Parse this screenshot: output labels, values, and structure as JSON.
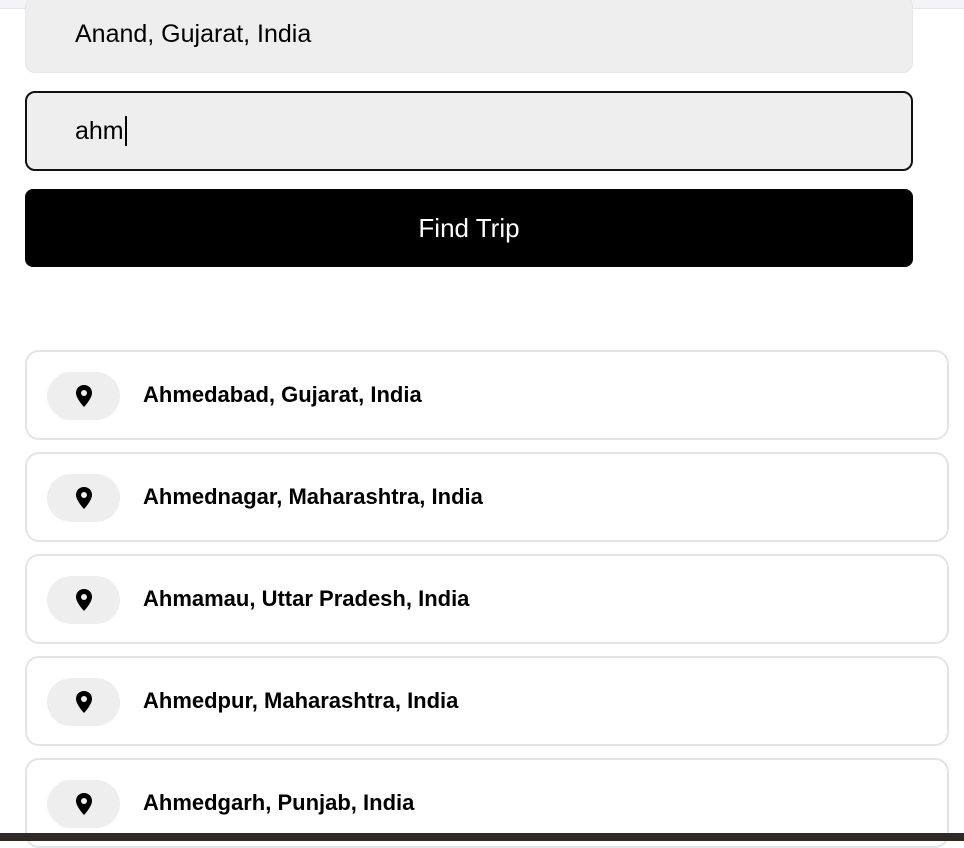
{
  "pickup": {
    "value": "Anand, Gujarat, India"
  },
  "destination": {
    "value": "ahm"
  },
  "find_trip_button": {
    "label": "Find Trip"
  },
  "suggestions": [
    {
      "label": "Ahmedabad, Gujarat, India",
      "icon": "map-pin-icon"
    },
    {
      "label": "Ahmednagar, Maharashtra, India",
      "icon": "map-pin-icon"
    },
    {
      "label": "Ahmamau, Uttar Pradesh, India",
      "icon": "map-pin-icon"
    },
    {
      "label": "Ahmedpur, Maharashtra, India",
      "icon": "map-pin-icon"
    },
    {
      "label": "Ahmedgarh, Punjab, India",
      "icon": "map-pin-icon"
    }
  ],
  "colors": {
    "button_bg": "#000000",
    "field_bg": "#eeeeee",
    "border_light": "#e4e4e4",
    "pin_bg": "#eeeeee"
  }
}
